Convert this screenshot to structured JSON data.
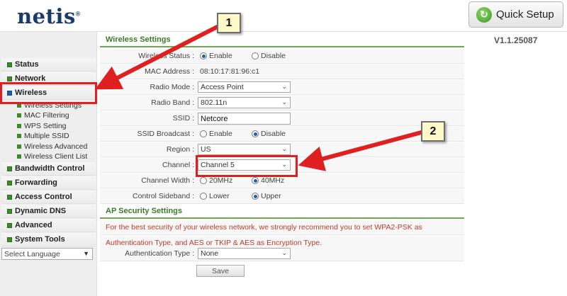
{
  "header": {
    "logo": "netis",
    "logo_mark": "®",
    "quick_setup_label": "Quick Setup",
    "version": "V1.1.25087"
  },
  "sidebar": {
    "items": [
      {
        "label": "Status"
      },
      {
        "label": "Network"
      },
      {
        "label": "Wireless"
      },
      {
        "label": "Bandwidth Control"
      },
      {
        "label": "Forwarding"
      },
      {
        "label": "Access Control"
      },
      {
        "label": "Dynamic DNS"
      },
      {
        "label": "Advanced"
      },
      {
        "label": "System Tools"
      }
    ],
    "wireless_submenu": [
      {
        "label": "Wireless Settings"
      },
      {
        "label": "MAC Filtering"
      },
      {
        "label": "WPS Setting"
      },
      {
        "label": "Multiple SSID"
      },
      {
        "label": "Wireless Advanced"
      },
      {
        "label": "Wireless Client List"
      }
    ],
    "language_select": "Select Language"
  },
  "wireless": {
    "section_title": "Wireless Settings",
    "status_label": "Wireless Status :",
    "status_enable": "Enable",
    "status_disable": "Disable",
    "mac_label": "MAC Address :",
    "mac_value": "08:10:17:81:96:c1",
    "mode_label": "Radio Mode :",
    "mode_value": "Access Point",
    "band_label": "Radio Band :",
    "band_value": "802.11n",
    "ssid_label": "SSID :",
    "ssid_value": "Netcore",
    "broadcast_label": "SSID Broadcast :",
    "broadcast_enable": "Enable",
    "broadcast_disable": "Disable",
    "region_label": "Region :",
    "region_value": "US",
    "channel_label": "Channel :",
    "channel_value": "Channel 5",
    "width_label": "Channel Width :",
    "width_20": "20MHz",
    "width_40": "40MHz",
    "sideband_label": "Control Sideband :",
    "sideband_lower": "Lower",
    "sideband_upper": "Upper"
  },
  "security": {
    "section_title": "AP Security Settings",
    "notice_line1": "For the best security of your wireless network, we strongly recommend you to set WPA2-PSK as",
    "notice_line2": "Authentication Type, and AES or TKIP & AES as Encryption Type.",
    "auth_label": "Authentication Type :",
    "auth_value": "None",
    "save_label": "Save"
  },
  "annotations": {
    "callout_1": "1",
    "callout_2": "2",
    "highlight_color": "#e02020"
  }
}
